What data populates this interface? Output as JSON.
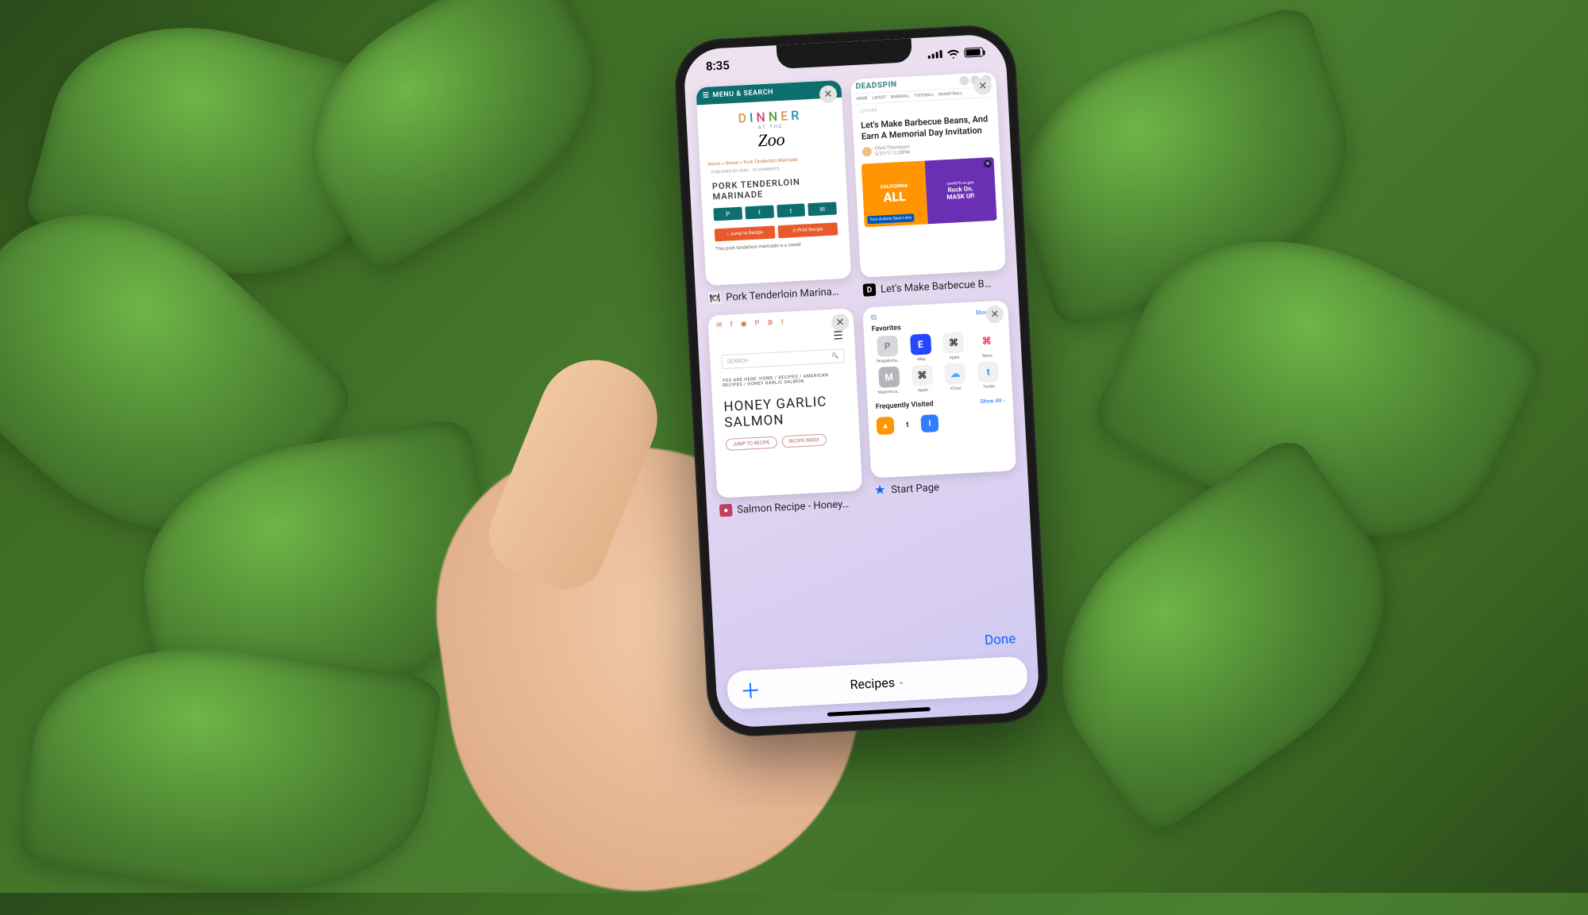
{
  "status_bar": {
    "time": "8:35"
  },
  "tabs": [
    {
      "caption": "Pork Tenderloin Marina…",
      "menu_label": "MENU & SEARCH",
      "site_logo_top": "DINNER",
      "site_logo_mid": "AT THE",
      "site_logo_bot": "Zoo",
      "breadcrumb": "Home » Dinner » Pork Tenderloin Marinade",
      "meta": "PUBLISHED BY SARA · 14 COMMENTS",
      "headline": "PORK TENDERLOIN MARINADE",
      "btn_jump": "↓ Jump to Recipe",
      "btn_print": "⎙ Print Recipe",
      "desc": "This pork tenderloin marinade is a sweet"
    },
    {
      "caption": "Let's Make Barbecue B…",
      "site": "DEADSPIN",
      "nav": [
        "HOME",
        "LATEST",
        "BASEBALL",
        "FOOTBALL",
        "BASKETBALL"
      ],
      "tag": "LOCKER",
      "headline": "Let's Make Barbecue Beans, And Earn A Memorial Day Invitation",
      "byline": "Chris Thompson",
      "date": "5/27/17 2:20PM",
      "ad_brand_top": "CALIFORNIA",
      "ad_brand": "ALL",
      "ad_tag": "Your Actions Save Lives",
      "ad_url": "covid19.ca.gov",
      "ad_msg1": "Rock On.",
      "ad_msg2": "MASK UP."
    },
    {
      "caption": "Salmon Recipe - Honey…",
      "search_placeholder": "SEARCH",
      "crumb": "YOU ARE HERE: HOME / RECIPES / AMERICAN RECIPES / HONEY GARLIC SALMON",
      "headline": "HONEY GARLIC SALMON",
      "btn_jump": "JUMP TO RECIPE",
      "btn_index": "RECIPE INDEX"
    },
    {
      "caption": "Start Page",
      "favorites_label": "Favorites",
      "show_all": "Show All",
      "freq_label": "Frequently Visited",
      "apps": [
        {
          "label": "PhilipMichaels.com",
          "letter": "P",
          "bg": "#d8d8dc",
          "fg": "#888"
        },
        {
          "label": "eBay",
          "letter": "E",
          "bg": "#2946ff",
          "fg": "#fff"
        },
        {
          "label": "Apple",
          "letter": "",
          "bg": "#f1f1f3",
          "fg": "#333"
        },
        {
          "label": "News",
          "letter": "",
          "bg": "#fff",
          "fg": "#ff2d55"
        },
        {
          "label": "Mashed cauliflow…",
          "letter": "M",
          "bg": "#b4b4ba",
          "fg": "#fff"
        },
        {
          "label": "Apple",
          "letter": "",
          "bg": "#f1f1f3",
          "fg": "#333"
        },
        {
          "label": "iCloud",
          "letter": "☁",
          "bg": "#f1f1f3",
          "fg": "#4aa7ff"
        },
        {
          "label": "Twitter",
          "letter": "t",
          "bg": "#f1f1f3",
          "fg": "#1da1f2"
        }
      ],
      "freq": [
        {
          "bg": "#ff9500",
          "fg": "#fff",
          "letter": "▲"
        },
        {
          "bg": "#fff",
          "fg": "#36465d",
          "letter": "t"
        },
        {
          "bg": "#2e7cff",
          "fg": "#fff",
          "letter": "I"
        }
      ]
    }
  ],
  "bottom": {
    "done": "Done",
    "group_name": "Recipes"
  }
}
